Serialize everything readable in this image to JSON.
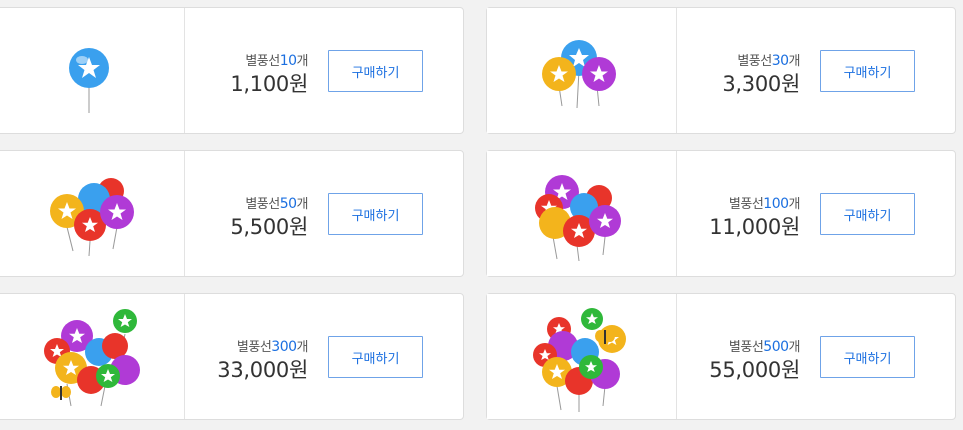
{
  "products": [
    {
      "name_label": "별풍선",
      "count": "10",
      "unit": "개",
      "price": "1,100원",
      "button": "구매하기",
      "image_icon": "balloon-10-icon"
    },
    {
      "name_label": "별풍선",
      "count": "30",
      "unit": "개",
      "price": "3,300원",
      "button": "구매하기",
      "image_icon": "balloon-30-icon"
    },
    {
      "name_label": "별풍선",
      "count": "50",
      "unit": "개",
      "price": "5,500원",
      "button": "구매하기",
      "image_icon": "balloon-50-icon"
    },
    {
      "name_label": "별풍선",
      "count": "100",
      "unit": "개",
      "price": "11,000원",
      "button": "구매하기",
      "image_icon": "balloon-100-icon"
    },
    {
      "name_label": "별풍선",
      "count": "300",
      "unit": "개",
      "price": "33,000원",
      "button": "구매하기",
      "image_icon": "balloon-300-icon"
    },
    {
      "name_label": "별풍선",
      "count": "500",
      "unit": "개",
      "price": "55,000원",
      "button": "구매하기",
      "image_icon": "balloon-500-icon"
    }
  ],
  "colors": {
    "accent": "#1b6fe0",
    "button_border": "#6fa3e8",
    "balloon_blue": "#3aa0ee",
    "balloon_yellow": "#f3b41c",
    "balloon_purple": "#b03ad6",
    "balloon_red": "#e8342a",
    "balloon_green": "#2fb83a"
  }
}
